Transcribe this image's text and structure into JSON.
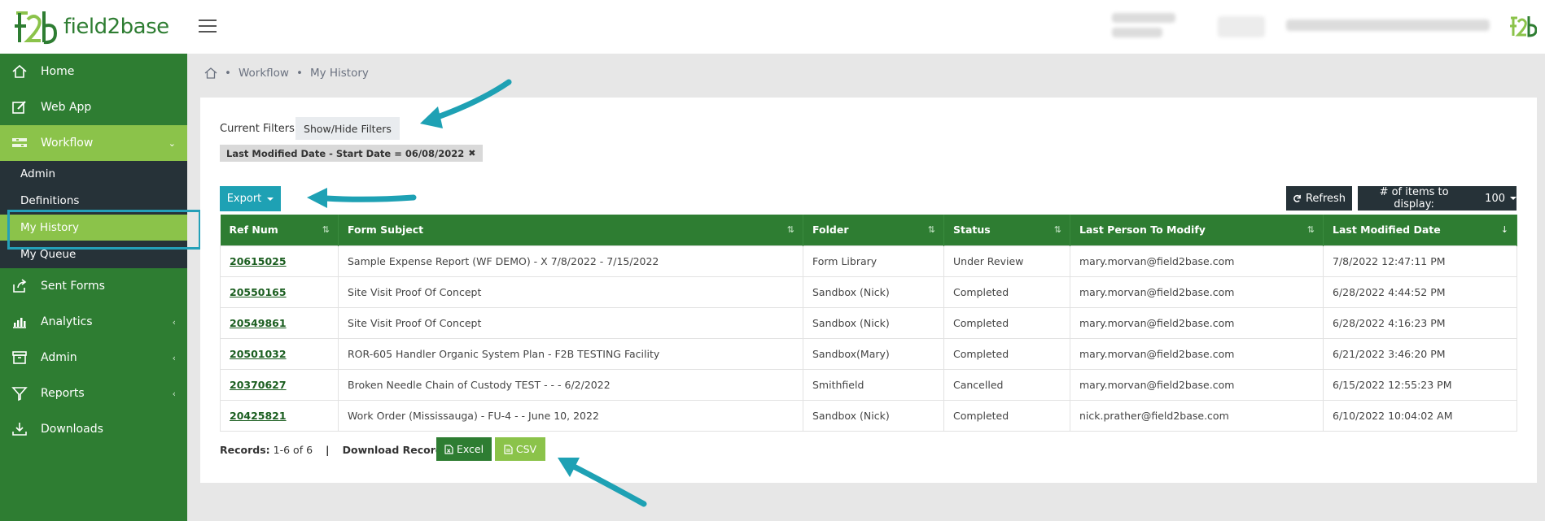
{
  "brand": {
    "name": "field2base",
    "primary": "#2e7d32",
    "accent": "#8bc34a",
    "dark": "#263238",
    "teal": "#1ea1b4"
  },
  "topbar": {
    "menu_icon": "hamburger-icon"
  },
  "sidebar": {
    "items": [
      {
        "label": "Home",
        "icon": "home-icon"
      },
      {
        "label": "Web App",
        "icon": "edit-icon"
      },
      {
        "label": "Workflow",
        "icon": "workflow-icon",
        "expanded": true
      },
      {
        "label": "Sent Forms",
        "icon": "share-icon"
      },
      {
        "label": "Analytics",
        "icon": "bar-chart-icon"
      },
      {
        "label": "Admin",
        "icon": "archive-icon"
      },
      {
        "label": "Reports",
        "icon": "filter-icon"
      },
      {
        "label": "Downloads",
        "icon": "download-icon"
      }
    ],
    "submenu": [
      {
        "label": "Admin"
      },
      {
        "label": "Definitions"
      },
      {
        "label": "My History",
        "active": true
      },
      {
        "label": "My Queue"
      }
    ]
  },
  "breadcrumb": {
    "items": [
      "Workflow",
      "My History"
    ]
  },
  "filters": {
    "label": "Current Filters:",
    "toggle_label": "Show/Hide Filters",
    "tag": "Last Modified Date - Start Date = 06/08/2022"
  },
  "toolbar": {
    "export_label": "Export",
    "refresh_label": "Refresh",
    "items_label": "# of items to display:",
    "items_value": "100"
  },
  "table": {
    "columns": [
      "Ref Num",
      "Form Subject",
      "Folder",
      "Status",
      "Last Person To Modify",
      "Last Modified Date"
    ],
    "rows": [
      [
        "20615025",
        "Sample Expense Report (WF DEMO) - X 7/8/2022 - 7/15/2022",
        "Form Library",
        "Under Review",
        "mary.morvan@field2base.com",
        "7/8/2022 12:47:11 PM"
      ],
      [
        "20550165",
        "Site Visit Proof Of Concept",
        "Sandbox (Nick)",
        "Completed",
        "mary.morvan@field2base.com",
        "6/28/2022 4:44:52 PM"
      ],
      [
        "20549861",
        "Site Visit Proof Of Concept",
        "Sandbox (Nick)",
        "Completed",
        "mary.morvan@field2base.com",
        "6/28/2022 4:16:23 PM"
      ],
      [
        "20501032",
        "ROR-605 Handler Organic System Plan - F2B TESTING Facility",
        "Sandbox(Mary)",
        "Completed",
        "mary.morvan@field2base.com",
        "6/21/2022 3:46:20 PM"
      ],
      [
        "20370627",
        "Broken Needle Chain of Custody TEST - - - 6/2/2022",
        "Smithfield",
        "Cancelled",
        "mary.morvan@field2base.com",
        "6/15/2022 12:55:23 PM"
      ],
      [
        "20425821",
        "Work Order (Mississauga) - FU-4 - - June 10, 2022",
        "Sandbox (Nick)",
        "Completed",
        "nick.prather@field2base.com",
        "6/10/2022 10:04:02 AM"
      ]
    ]
  },
  "footer": {
    "records_label": "Records:",
    "records_value": "1-6 of 6",
    "separator": "|",
    "download_label": "Download Records",
    "excel_label": "Excel",
    "csv_label": "CSV"
  }
}
